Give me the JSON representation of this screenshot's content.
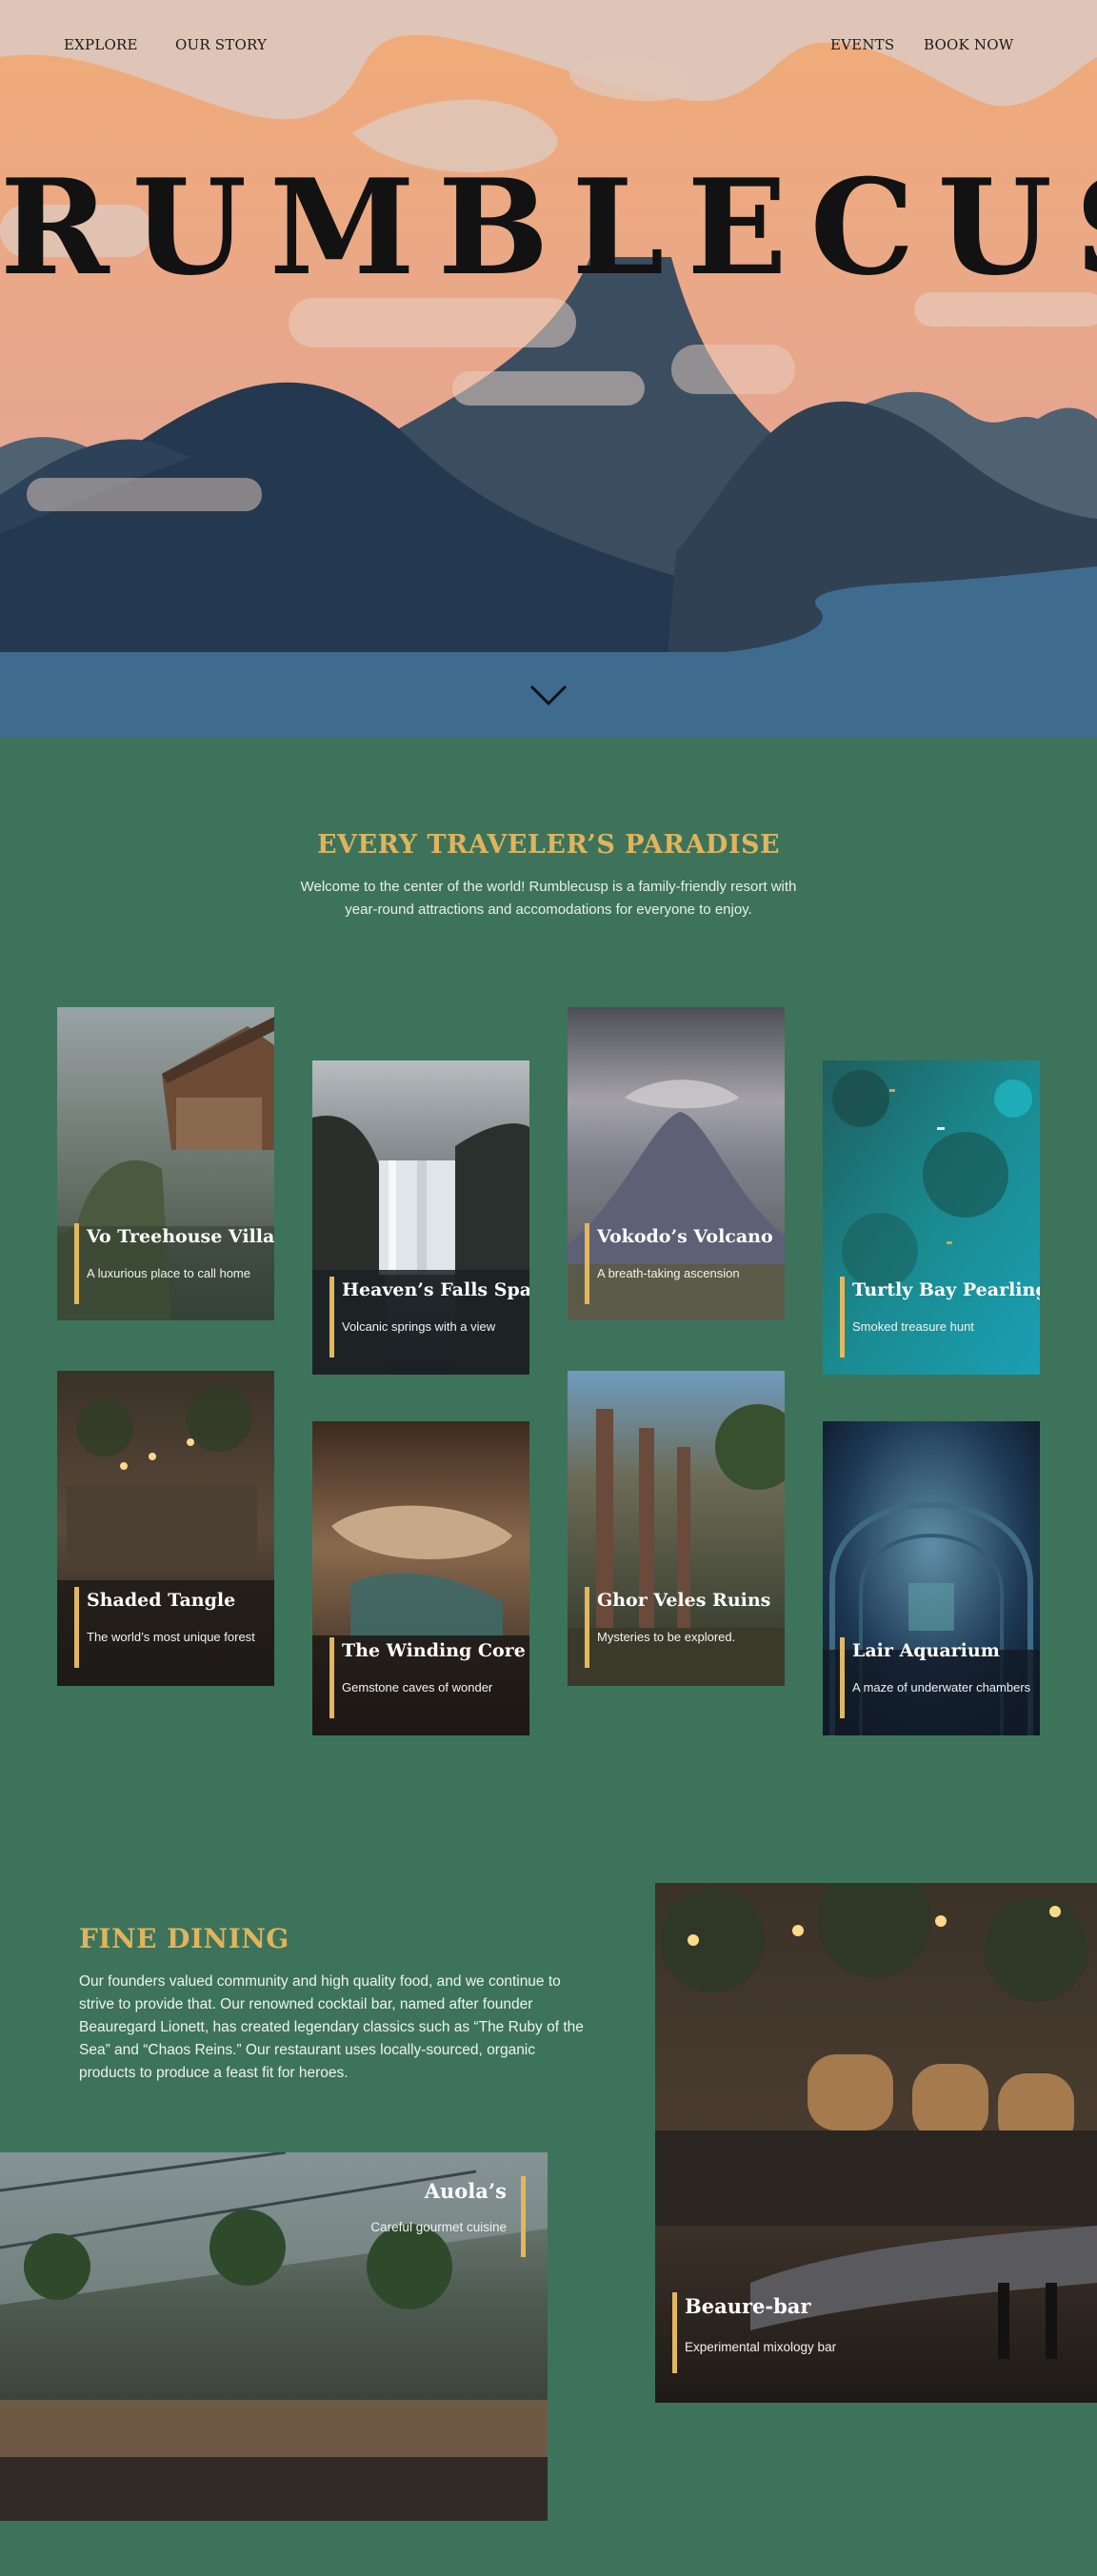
{
  "nav": {
    "explore": "EXPLORE",
    "our_story": "OUR STORY",
    "events": "EVENTS",
    "book_now": "BOOK NOW"
  },
  "hero": {
    "brand": "RUMBLECUSP",
    "scroll_icon": "chevron-down-icon"
  },
  "intro": {
    "title": "EVERY TRAVELER’S PARADISE",
    "text": "Welcome to the center of the world! Rumblecusp is a family-friendly resort with year-round attractions and accomodations for everyone to enjoy."
  },
  "attractions": [
    {
      "title": "Vo Treehouse Villas",
      "subtitle": "A luxurious place to call home"
    },
    {
      "title": "Heaven’s Falls Spa",
      "subtitle": "Volcanic springs with a view"
    },
    {
      "title": "Vokodo’s Volcano",
      "subtitle": "A breath-taking ascension"
    },
    {
      "title": "Turtly Bay Pearling",
      "subtitle": "Smoked treasure hunt"
    },
    {
      "title": "Shaded Tangle",
      "subtitle": "The world’s most unique forest"
    },
    {
      "title": "The Winding Core",
      "subtitle": "Gemstone caves of wonder"
    },
    {
      "title": "Ghor Veles Ruins",
      "subtitle": "Mysteries to be explored."
    },
    {
      "title": "Lair Aquarium",
      "subtitle": "A maze of underwater chambers"
    }
  ],
  "dining": {
    "title": "FINE DINING",
    "text": "Our founders valued community and high quality food, and we continue to strive to provide that. Our renowned cocktail bar, named after founder Beauregard Lionett, has created legendary classics such as “The Ruby of the Sea” and “Chaos Reins.” Our restaurant uses locally-sourced, organic products to produce a feast fit for heroes.",
    "venues": [
      {
        "title": "Beaure-bar",
        "subtitle": "Experimental mixology bar"
      },
      {
        "title": "Auola’s",
        "subtitle": "Careful gourmet cuisine"
      }
    ]
  },
  "colors": {
    "page_background": "#3d735b",
    "accent_gold": "#e0b45c",
    "sky_peach": "#eaa97f",
    "mountain_dark": "#24394f",
    "lake_blue": "#3f6b8e"
  }
}
